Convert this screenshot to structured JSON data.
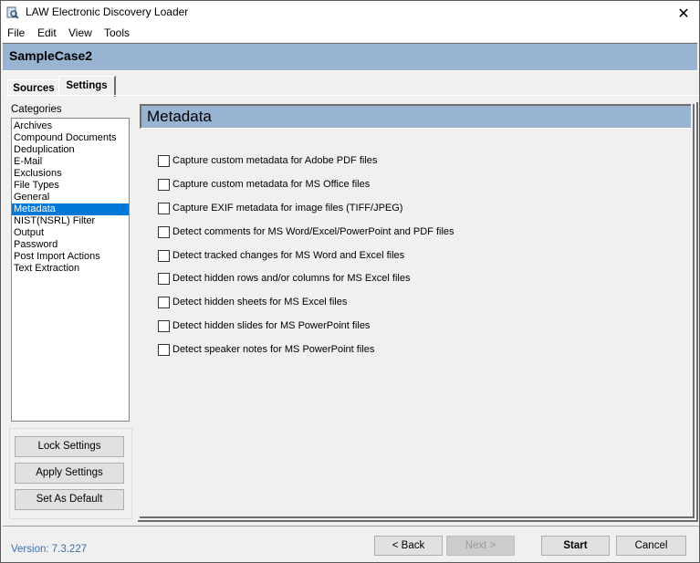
{
  "window": {
    "title": "LAW Electronic Discovery Loader",
    "close_glyph": "✕"
  },
  "menu": [
    "File",
    "Edit",
    "View",
    "Tools"
  ],
  "case": {
    "name": "SampleCase2"
  },
  "tabs": [
    {
      "label": "Sources",
      "active": false
    },
    {
      "label": "Settings",
      "active": true
    }
  ],
  "sidebar": {
    "categories_label": "Categories",
    "selected": "Metadata",
    "items": [
      "Archives",
      "Compound Documents",
      "Deduplication",
      "E-Mail",
      "Exclusions",
      "File Types",
      "General",
      "Metadata",
      "NIST(NSRL) Filter",
      "Output",
      "Password",
      "Post Import Actions",
      "Text Extraction"
    ],
    "buttons": {
      "lock": "Lock Settings",
      "apply": "Apply Settings",
      "default": "Set As Default"
    }
  },
  "panel": {
    "title": "Metadata",
    "options": [
      {
        "label": "Capture custom metadata for Adobe PDF files",
        "checked": false
      },
      {
        "label": "Capture custom metadata for MS Office files",
        "checked": false
      },
      {
        "label": "Capture EXIF metadata for image files (TIFF/JPEG)",
        "checked": false
      },
      {
        "label": "Detect comments for MS Word/Excel/PowerPoint and PDF files",
        "checked": false
      },
      {
        "label": "Detect tracked changes for MS Word and Excel files",
        "checked": false
      },
      {
        "label": "Detect hidden rows and/or columns for MS Excel files",
        "checked": false
      },
      {
        "label": "Detect hidden sheets for MS Excel files",
        "checked": false
      },
      {
        "label": "Detect hidden slides for MS PowerPoint files",
        "checked": false
      },
      {
        "label": "Detect speaker notes for MS PowerPoint files",
        "checked": false
      }
    ]
  },
  "footer": {
    "version": "Version: 7.3.227",
    "back": "< Back",
    "next": "Next >",
    "start": "Start",
    "cancel": "Cancel"
  },
  "colors": {
    "header_bg": "#98b4d2",
    "selection": "#0078d7",
    "version_text": "#3c6ea8"
  }
}
